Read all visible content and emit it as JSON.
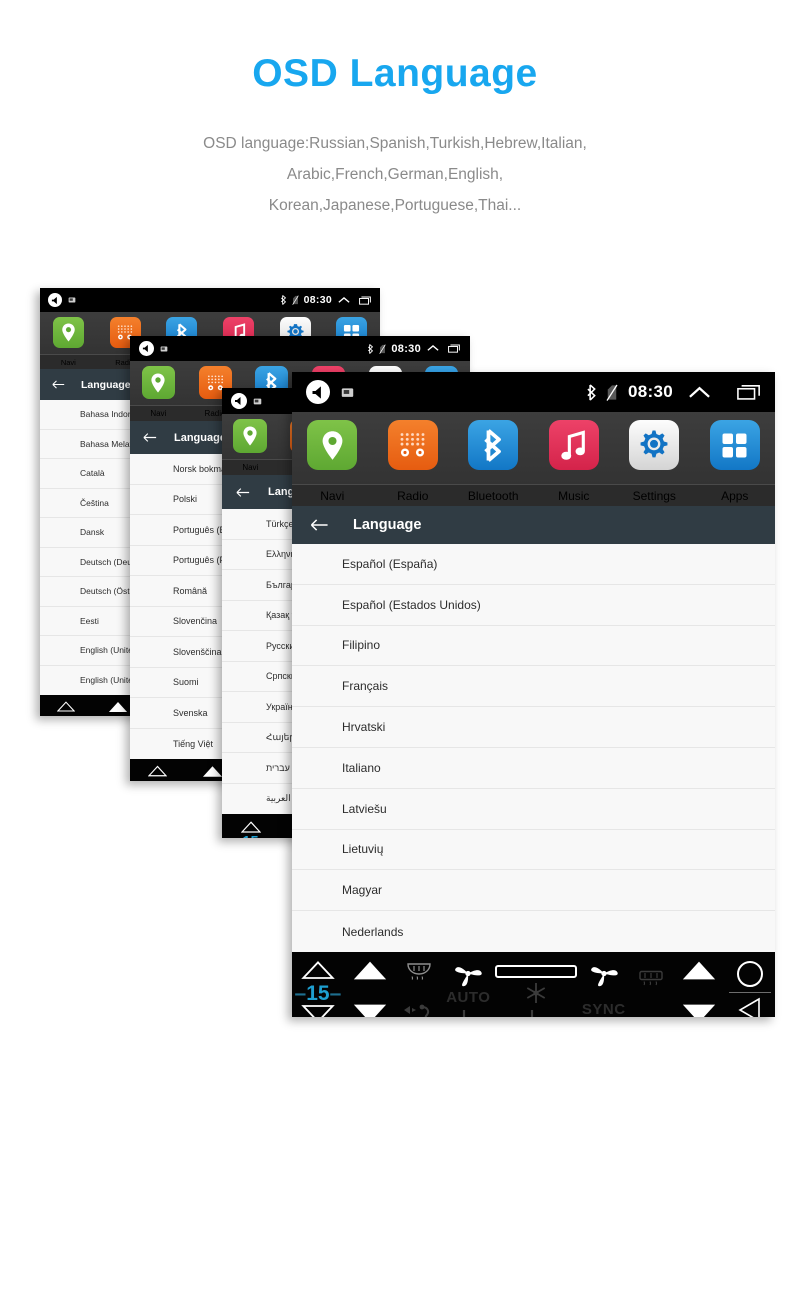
{
  "header": {
    "title": "OSD Language",
    "desc_lines": [
      "OSD language:Russian,Spanish,Turkish,Hebrew,Italian,",
      "Arabic,French,German,English,",
      "Korean,Japanese,Portuguese,Thai..."
    ]
  },
  "colors": {
    "title_blue": "#18a7ef",
    "desc_gray": "#8a8a8a",
    "statusbar_black": "#000000",
    "dock_dark": "#3a3a3a",
    "titlebar_slate": "#303c44",
    "list_bg": "#f8f8f8",
    "temp_cyan": "#1e9fd0",
    "navi_green": "#6cb33f",
    "radio_orange": "#ef6c1a",
    "bluetooth_blue": "#1e8fd5",
    "music_crimson": "#e03156",
    "settings_silver": "#e8e8e8",
    "settings_gear_blue": "#1273c4",
    "apps_blue": "#1e8fd5"
  },
  "statusbar": {
    "back_icon": "back-volume-icon",
    "screenshot_icon": "screenshot-icon",
    "bluetooth_icon": "bluetooth-icon",
    "signal_icon": "no-sim-icon",
    "clock": "08:30",
    "chevron_up_icon": "chevron-up-icon",
    "recents_icon": "recents-icon"
  },
  "dock": {
    "items": [
      {
        "label": "Navi",
        "icon": "location-pin-icon"
      },
      {
        "label": "Radio",
        "icon": "radio-icon"
      },
      {
        "label": "Bluetooth",
        "icon": "bluetooth-icon"
      },
      {
        "label": "Music",
        "icon": "music-note-icon"
      },
      {
        "label": "Settings",
        "icon": "gear-icon"
      },
      {
        "label": "Apps",
        "icon": "apps-grid-icon"
      }
    ]
  },
  "titlebar": {
    "back_arrow_icon": "arrow-left-icon",
    "title": "Language"
  },
  "climate": {
    "temp_value": "15",
    "temp_up_icon": "triangle-up-outline-icon",
    "temp_down_icon": "triangle-down-outline-icon",
    "vol_up_icon": "triangle-up-solid-icon",
    "vol_down_icon": "triangle-down-solid-icon",
    "defrost_front_icon": "defrost-front-icon",
    "defrost_rear_icon": "defrost-rear-icon",
    "fan_left_icon": "fan-icon",
    "fan_right_icon": "fan-icon",
    "auto_label": "AUTO",
    "sync_label": "SYNC",
    "snowflake_icon": "snowflake-icon",
    "airflow_icon": "airflow-icon",
    "seat_left_icon": "seat-heater-icon",
    "seat_right_icon": "seat-heater-icon",
    "home_icon": "circle-home-icon",
    "back_icon": "triangle-left-back-icon"
  },
  "panels": [
    {
      "id": "panel-1",
      "languages": [
        "Bahasa Indonesia",
        "Bahasa Melayu",
        "Català",
        "Čeština",
        "Dansk",
        "Deutsch (Deutschland)",
        "Deutsch (Österreich)",
        "Eesti",
        "English (United Kingdom)",
        "English (United States)"
      ]
    },
    {
      "id": "panel-2",
      "languages": [
        "Norsk bokmål",
        "Polski",
        "Português (Brasil)",
        "Português (Portugal)",
        "Română",
        "Slovenčina",
        "Slovenščina",
        "Suomi",
        "Svenska",
        "Tiếng Việt"
      ]
    },
    {
      "id": "panel-3",
      "languages": [
        "Türkçe",
        "Ελληνικά",
        "Български",
        "Қазақ тілі",
        "Русский",
        "Српски",
        "Українська",
        "Հայերեն",
        "עברית",
        "العربية"
      ]
    },
    {
      "id": "panel-4",
      "languages": [
        "Español (España)",
        "Español (Estados Unidos)",
        "Filipino",
        "Français",
        "Hrvatski",
        "Italiano",
        "Latviešu",
        "Lietuvių",
        "Magyar",
        "Nederlands"
      ]
    }
  ]
}
